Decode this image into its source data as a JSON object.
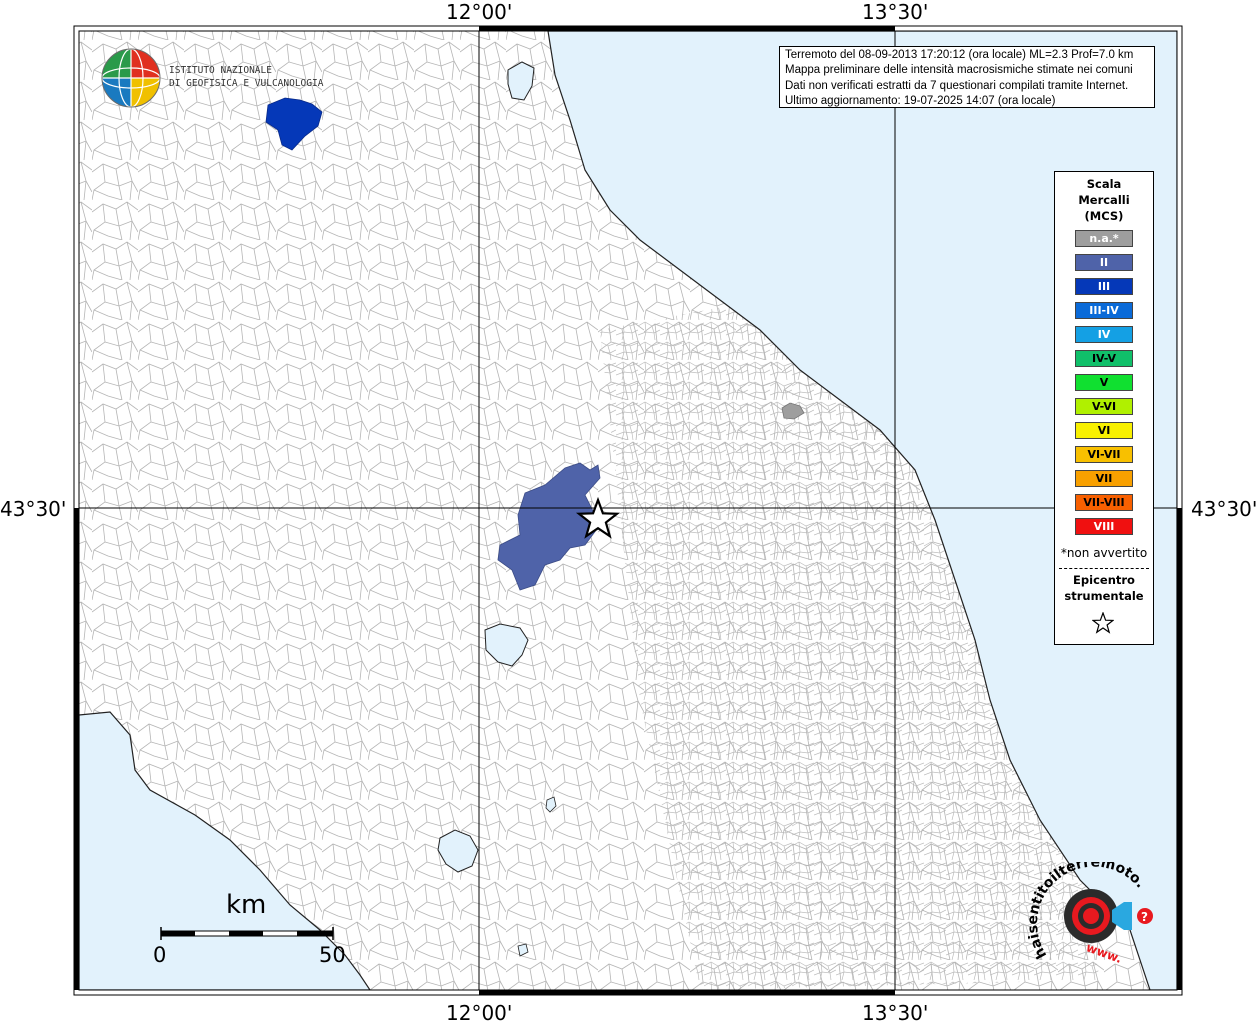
{
  "coordinates": {
    "lon_left": "12°00'",
    "lon_right": "13°30'",
    "lat": "43°30'"
  },
  "info": {
    "line1": "Terremoto del 08-09-2013 17:20:12 (ora locale) ML=2.3 Prof=7.0 km",
    "line2": "Mappa preliminare delle intensità macrosismiche stimate nei comuni",
    "line3": "Dati non verificati estratti da 7 questionari compilati tramite Internet.",
    "line4": "Ultimo aggiornamento: 19-07-2025 14:07 (ora locale)"
  },
  "logo": {
    "line1": "ISTITUTO NAZIONALE",
    "line2": "DI GEOFISICA E VULCANOLOGIA",
    "icon": "ingv-globe-icon"
  },
  "legend": {
    "title1": "Scala",
    "title2": "Mercalli",
    "title3": "(MCS)",
    "items": [
      {
        "label": "n.a.*",
        "color": "#9e9e9e",
        "text": "#ffffff"
      },
      {
        "label": "II",
        "color": "#4f63a9",
        "text": "#ffffff"
      },
      {
        "label": "III",
        "color": "#0538b8",
        "text": "#ffffff"
      },
      {
        "label": "III-IV",
        "color": "#0a6ad8",
        "text": "#ffffff"
      },
      {
        "label": "IV",
        "color": "#14a0e4",
        "text": "#ffffff"
      },
      {
        "label": "IV-V",
        "color": "#10c06a",
        "text": "#000000"
      },
      {
        "label": "V",
        "color": "#10e030",
        "text": "#000000"
      },
      {
        "label": "V-VI",
        "color": "#b0f000",
        "text": "#000000"
      },
      {
        "label": "VI",
        "color": "#f8f000",
        "text": "#000000"
      },
      {
        "label": "VI-VII",
        "color": "#f8c000",
        "text": "#000000"
      },
      {
        "label": "VII",
        "color": "#f8a000",
        "text": "#000000"
      },
      {
        "label": "VII-VIII",
        "color": "#f86000",
        "text": "#000000"
      },
      {
        "label": "VIII",
        "color": "#f01010",
        "text": "#ffffff"
      }
    ],
    "note": "*non avvertito",
    "epicenter1": "Epicentro",
    "epicenter2": "strumentale",
    "epicenter_icon": "star-icon"
  },
  "scalebar": {
    "unit": "km",
    "start": "0",
    "end": "50"
  },
  "hst": {
    "text": "haisentitoilterremoto.it",
    "www": "www.",
    "icon": "speaker-icon"
  },
  "colors": {
    "sea": "#e2f2fc",
    "land": "#ffffff",
    "borders": "#a8a8a8"
  }
}
